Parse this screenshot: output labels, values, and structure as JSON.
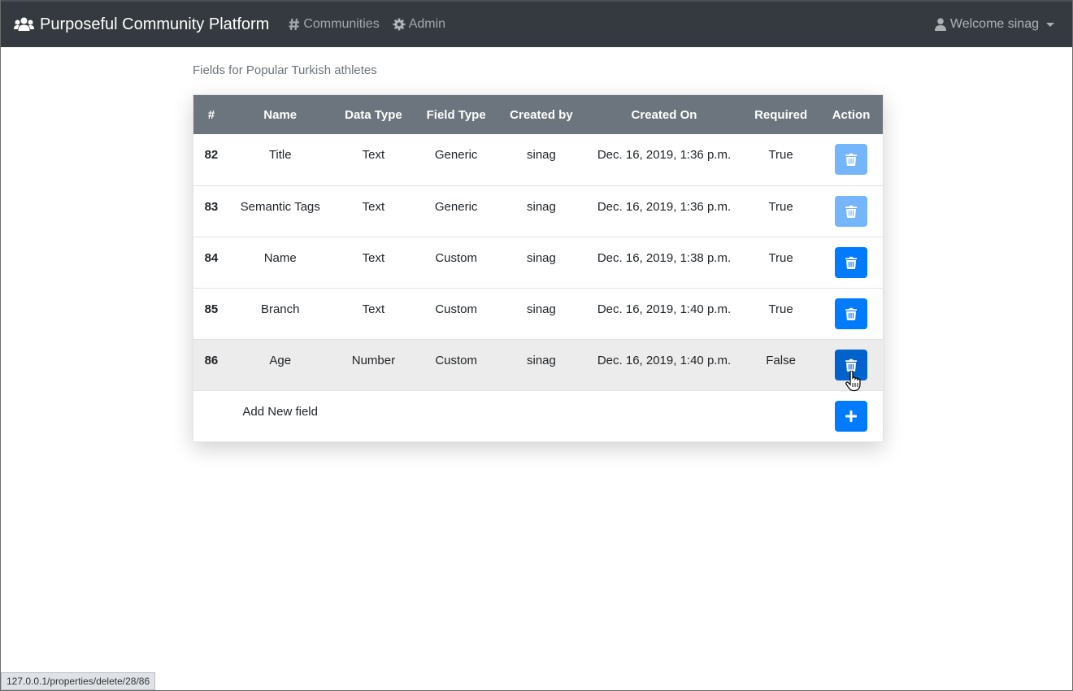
{
  "navbar": {
    "brand": "Purposeful Community Platform",
    "brand_icon": "users-icon",
    "links": [
      {
        "label": "Communities",
        "icon": "hashtag-icon"
      },
      {
        "label": "Admin",
        "icon": "gear-icon"
      }
    ],
    "user_menu": {
      "label": "Welcome sinag",
      "icon": "user-icon"
    }
  },
  "page": {
    "subtitle": "Fields for Popular Turkish athletes"
  },
  "table": {
    "headers": [
      "#",
      "Name",
      "Data Type",
      "Field Type",
      "Created by",
      "Created On",
      "Required",
      "Action"
    ],
    "rows": [
      {
        "id": "82",
        "name": "Title",
        "data_type": "Text",
        "field_type": "Generic",
        "created_by": "sinag",
        "created_on": "Dec. 16, 2019, 1:36 p.m.",
        "required": "True",
        "delete_enabled": false
      },
      {
        "id": "83",
        "name": "Semantic Tags",
        "data_type": "Text",
        "field_type": "Generic",
        "created_by": "sinag",
        "created_on": "Dec. 16, 2019, 1:36 p.m.",
        "required": "True",
        "delete_enabled": false
      },
      {
        "id": "84",
        "name": "Name",
        "data_type": "Text",
        "field_type": "Custom",
        "created_by": "sinag",
        "created_on": "Dec. 16, 2019, 1:38 p.m.",
        "required": "True",
        "delete_enabled": true
      },
      {
        "id": "85",
        "name": "Branch",
        "data_type": "Text",
        "field_type": "Custom",
        "created_by": "sinag",
        "created_on": "Dec. 16, 2019, 1:40 p.m.",
        "required": "True",
        "delete_enabled": true
      },
      {
        "id": "86",
        "name": "Age",
        "data_type": "Number",
        "field_type": "Custom",
        "created_by": "sinag",
        "created_on": "Dec. 16, 2019, 1:40 p.m.",
        "required": "False",
        "delete_enabled": true
      }
    ],
    "add_label": "Add New field"
  },
  "status_bar": {
    "url": "127.0.0.1/properties/delete/28/86"
  },
  "colors": {
    "navbar_bg": "#343a40",
    "table_header_bg": "#6c757d",
    "primary": "#007bff",
    "primary_disabled": "#66aefc"
  }
}
